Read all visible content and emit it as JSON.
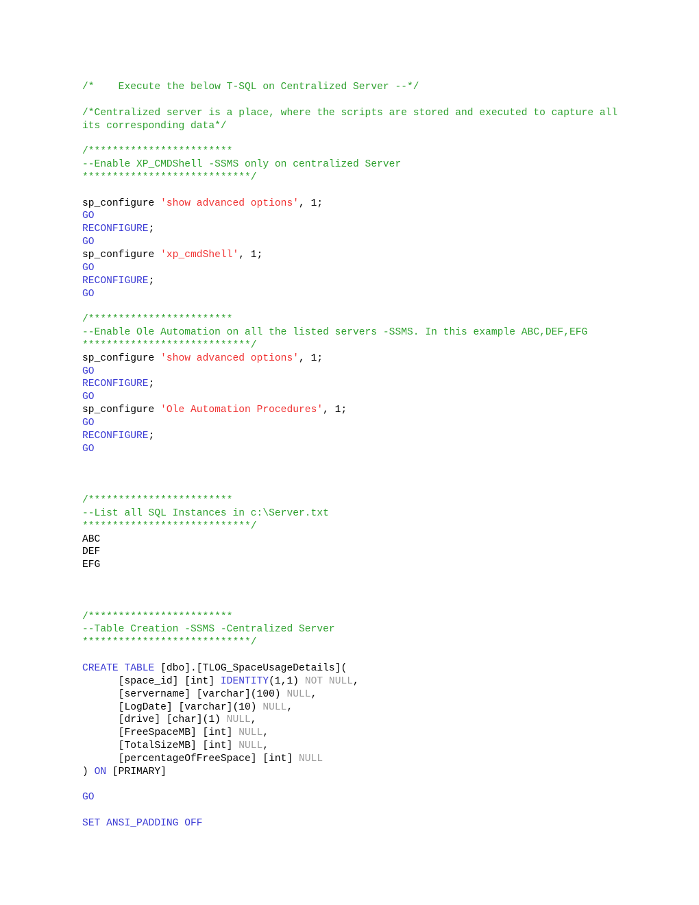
{
  "document": {
    "type": "t-sql-script",
    "colors": {
      "comment_green": "#2FA12F",
      "keyword_blue": "#3B3BD4",
      "string_red": "#F03232",
      "null_gray": "#9A9A9A",
      "plain_black": "#000000",
      "background": "#FFFFFF"
    },
    "lines": [
      {
        "id": "l1",
        "segments": [
          {
            "text": "/*    Execute the below T-SQL on Centralized Server --*/",
            "style": "comment"
          }
        ]
      },
      {
        "id": "l2",
        "segments": []
      },
      {
        "id": "l3",
        "segments": [
          {
            "text": "/*Centralized server is a place, where the scripts are stored and executed to capture all its corresponding data*/",
            "style": "comment"
          }
        ]
      },
      {
        "id": "l4",
        "segments": []
      },
      {
        "id": "l5",
        "segments": [
          {
            "text": "/************************",
            "style": "comment"
          }
        ]
      },
      {
        "id": "l6",
        "segments": [
          {
            "text": "--Enable XP_CMDShell -SSMS only on centralized Server",
            "style": "comment"
          }
        ]
      },
      {
        "id": "l7",
        "segments": [
          {
            "text": "****************************/",
            "style": "comment"
          }
        ]
      },
      {
        "id": "l8",
        "segments": []
      },
      {
        "id": "l9",
        "segments": [
          {
            "text": "sp_configure ",
            "style": "plain"
          },
          {
            "text": "'show advanced options'",
            "style": "string"
          },
          {
            "text": ", 1;",
            "style": "plain"
          }
        ]
      },
      {
        "id": "l10",
        "segments": [
          {
            "text": "GO",
            "style": "keyword"
          }
        ]
      },
      {
        "id": "l11",
        "segments": [
          {
            "text": "RECONFIGURE",
            "style": "keyword"
          },
          {
            "text": ";",
            "style": "plain"
          }
        ]
      },
      {
        "id": "l12",
        "segments": [
          {
            "text": "GO",
            "style": "keyword"
          }
        ]
      },
      {
        "id": "l13",
        "segments": [
          {
            "text": "sp_configure ",
            "style": "plain"
          },
          {
            "text": "'xp_cmdShell'",
            "style": "string"
          },
          {
            "text": ", 1;",
            "style": "plain"
          }
        ]
      },
      {
        "id": "l14",
        "segments": [
          {
            "text": "GO",
            "style": "keyword"
          }
        ]
      },
      {
        "id": "l15",
        "segments": [
          {
            "text": "RECONFIGURE",
            "style": "keyword"
          },
          {
            "text": ";",
            "style": "plain"
          }
        ]
      },
      {
        "id": "l16",
        "segments": [
          {
            "text": "GO",
            "style": "keyword"
          }
        ]
      },
      {
        "id": "l17",
        "segments": []
      },
      {
        "id": "l18",
        "segments": [
          {
            "text": "/************************",
            "style": "comment"
          }
        ]
      },
      {
        "id": "l19",
        "segments": [
          {
            "text": "--Enable Ole Automation on all the listed servers -SSMS. In this example ABC,DEF,EFG",
            "style": "comment"
          }
        ]
      },
      {
        "id": "l20",
        "segments": [
          {
            "text": "****************************/",
            "style": "comment"
          }
        ]
      },
      {
        "id": "l21",
        "segments": [
          {
            "text": "sp_configure ",
            "style": "plain"
          },
          {
            "text": "'show advanced options'",
            "style": "string"
          },
          {
            "text": ", 1;",
            "style": "plain"
          }
        ]
      },
      {
        "id": "l22",
        "segments": [
          {
            "text": "GO",
            "style": "keyword"
          }
        ]
      },
      {
        "id": "l23",
        "segments": [
          {
            "text": "RECONFIGURE",
            "style": "keyword"
          },
          {
            "text": ";",
            "style": "plain"
          }
        ]
      },
      {
        "id": "l24",
        "segments": [
          {
            "text": "GO",
            "style": "keyword"
          }
        ]
      },
      {
        "id": "l25",
        "segments": [
          {
            "text": "sp_configure ",
            "style": "plain"
          },
          {
            "text": "'Ole Automation Procedures'",
            "style": "string"
          },
          {
            "text": ", 1;",
            "style": "plain"
          }
        ]
      },
      {
        "id": "l26",
        "segments": [
          {
            "text": "GO",
            "style": "keyword"
          }
        ]
      },
      {
        "id": "l27",
        "segments": [
          {
            "text": "RECONFIGURE",
            "style": "keyword"
          },
          {
            "text": ";",
            "style": "plain"
          }
        ]
      },
      {
        "id": "l28",
        "segments": [
          {
            "text": "GO",
            "style": "keyword"
          }
        ]
      },
      {
        "id": "l29",
        "segments": []
      },
      {
        "id": "l30",
        "segments": []
      },
      {
        "id": "l31",
        "segments": []
      },
      {
        "id": "l32",
        "segments": [
          {
            "text": "/************************",
            "style": "comment"
          }
        ]
      },
      {
        "id": "l33",
        "segments": [
          {
            "text": "--List all SQL Instances in c:\\Server.txt",
            "style": "comment"
          }
        ]
      },
      {
        "id": "l34",
        "segments": [
          {
            "text": "****************************/",
            "style": "comment"
          }
        ]
      },
      {
        "id": "l35",
        "segments": [
          {
            "text": "ABC",
            "style": "plain"
          }
        ]
      },
      {
        "id": "l36",
        "segments": [
          {
            "text": "DEF",
            "style": "plain"
          }
        ]
      },
      {
        "id": "l37",
        "segments": [
          {
            "text": "EFG",
            "style": "plain"
          }
        ]
      },
      {
        "id": "l38",
        "segments": []
      },
      {
        "id": "l39",
        "segments": []
      },
      {
        "id": "l40",
        "segments": []
      },
      {
        "id": "l41",
        "segments": [
          {
            "text": "/************************",
            "style": "comment"
          }
        ]
      },
      {
        "id": "l42",
        "segments": [
          {
            "text": "--Table Creation -SSMS -Centralized Server",
            "style": "comment"
          }
        ]
      },
      {
        "id": "l43",
        "segments": [
          {
            "text": "****************************/",
            "style": "comment"
          }
        ]
      },
      {
        "id": "l44",
        "segments": []
      },
      {
        "id": "l45",
        "segments": [
          {
            "text": "CREATE TABLE ",
            "style": "keyword"
          },
          {
            "text": "[dbo].[TLOG_SpaceUsageDetails](",
            "style": "plain"
          }
        ]
      },
      {
        "id": "l46",
        "segments": [
          {
            "text": "      [space_id] [int] ",
            "style": "plain"
          },
          {
            "text": "IDENTITY",
            "style": "keyword"
          },
          {
            "text": "(1,1) ",
            "style": "plain"
          },
          {
            "text": "NOT NULL",
            "style": "null"
          },
          {
            "text": ",",
            "style": "plain"
          }
        ]
      },
      {
        "id": "l47",
        "segments": [
          {
            "text": "      [servername] [varchar](100) ",
            "style": "plain"
          },
          {
            "text": "NULL",
            "style": "null"
          },
          {
            "text": ",",
            "style": "plain"
          }
        ]
      },
      {
        "id": "l48",
        "segments": [
          {
            "text": "      [LogDate] [varchar](10) ",
            "style": "plain"
          },
          {
            "text": "NULL",
            "style": "null"
          },
          {
            "text": ",",
            "style": "plain"
          }
        ]
      },
      {
        "id": "l49",
        "segments": [
          {
            "text": "      [drive] [char](1) ",
            "style": "plain"
          },
          {
            "text": "NULL",
            "style": "null"
          },
          {
            "text": ",",
            "style": "plain"
          }
        ]
      },
      {
        "id": "l50",
        "segments": [
          {
            "text": "      [FreeSpaceMB] [int] ",
            "style": "plain"
          },
          {
            "text": "NULL",
            "style": "null"
          },
          {
            "text": ",",
            "style": "plain"
          }
        ]
      },
      {
        "id": "l51",
        "segments": [
          {
            "text": "      [TotalSizeMB] [int] ",
            "style": "plain"
          },
          {
            "text": "NULL",
            "style": "null"
          },
          {
            "text": ",",
            "style": "plain"
          }
        ]
      },
      {
        "id": "l52",
        "segments": [
          {
            "text": "      [percentageOfFreeSpace] [int] ",
            "style": "plain"
          },
          {
            "text": "NULL",
            "style": "null"
          }
        ]
      },
      {
        "id": "l53",
        "segments": [
          {
            "text": ") ",
            "style": "plain"
          },
          {
            "text": "ON",
            "style": "keyword"
          },
          {
            "text": " [PRIMARY]",
            "style": "plain"
          }
        ]
      },
      {
        "id": "l54",
        "segments": []
      },
      {
        "id": "l55",
        "segments": [
          {
            "text": "GO",
            "style": "keyword"
          }
        ]
      },
      {
        "id": "l56",
        "segments": []
      },
      {
        "id": "l57",
        "segments": [
          {
            "text": "SET ANSI_PADDING OFF",
            "style": "keyword"
          }
        ]
      }
    ]
  }
}
